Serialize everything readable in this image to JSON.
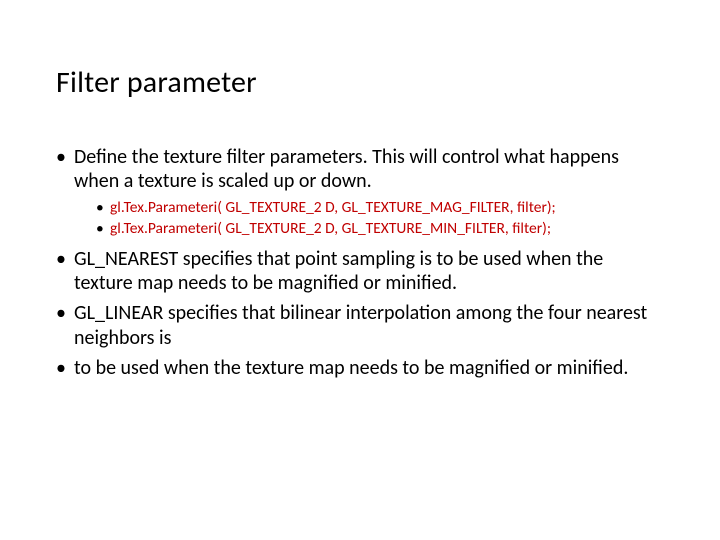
{
  "title": "Filter parameter",
  "bullets": {
    "b1": "Define the texture filter parameters. This will control what happens when a texture is scaled up or down.",
    "sub1": "gl.Tex.Parameteri( GL_TEXTURE_2 D, GL_TEXTURE_MAG_FILTER, filter);",
    "sub2": "gl.Tex.Parameteri( GL_TEXTURE_2 D, GL_TEXTURE_MIN_FILTER, filter);",
    "b2": "GL_NEAREST specifies that point sampling is to be used when the texture map needs to be magnified or minified.",
    "b3": "GL_LINEAR specifies that bilinear interpolation among the four nearest neighbors is",
    "b4": "to be used when the texture map needs to be magnified or minified."
  }
}
